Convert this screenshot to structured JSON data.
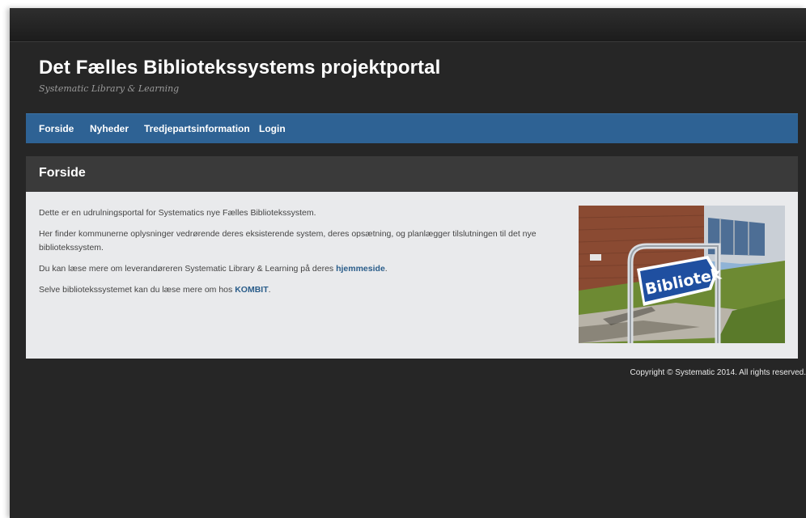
{
  "site": {
    "title": "Det Fælles Bibliotekssystems projektportal",
    "subtitle": "Systematic Library & Learning"
  },
  "nav": {
    "items": [
      "Forside",
      "Nyheder",
      "Tredjepartsinformation",
      "Login"
    ]
  },
  "page": {
    "heading": "Forside",
    "p1": "Dette er en udrulningsportal for Systematics nye Fælles Bibliotekssystem.",
    "p2": "Her finder kommunerne oplysninger vedrørende deres eksisterende system, deres opsætning, og planlægger tilslutningen til det nye bibliotekssystem.",
    "p3_before": "Du kan læse mere om leverandøreren Systematic Library & Learning på deres ",
    "p3_link": "hjemmeside",
    "p3_after": ".",
    "p4_before": "Selve bibliotekssystemet kan du læse mere om hos ",
    "p4_link": "KOMBIT",
    "p4_after": "."
  },
  "image": {
    "sign_text": "Bibliotek"
  },
  "footer": {
    "copyright": "Copyright © Systematic 2014. All rights reserved."
  },
  "colors": {
    "nav_bar": "#2e6294",
    "background": "#262626",
    "content_bg": "#e9eaec",
    "link": "#2a5d8a"
  }
}
